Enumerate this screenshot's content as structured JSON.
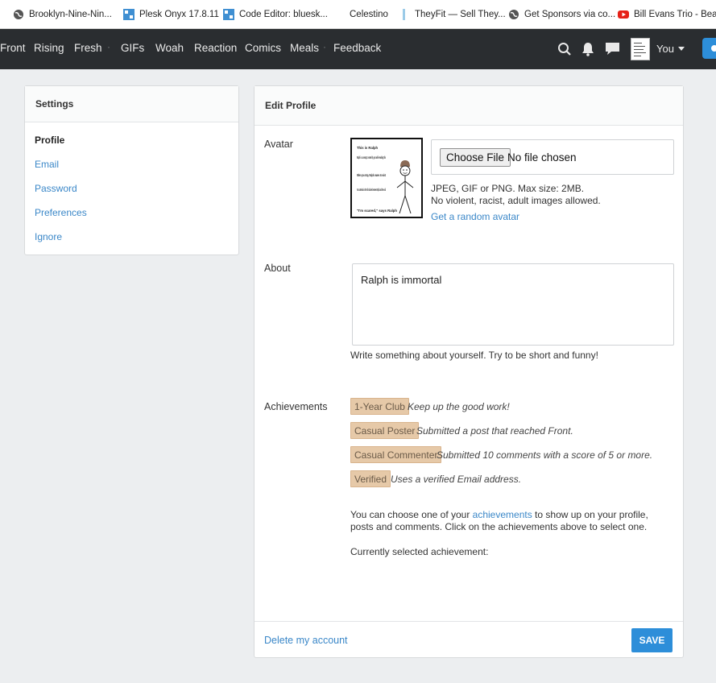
{
  "bookmarks": [
    {
      "label": "Brooklyn-Nine-Nin...",
      "icon": "globe-icon"
    },
    {
      "label": "Plesk Onyx 17.8.11",
      "icon": "plesk-icon"
    },
    {
      "label": "Code Editor: bluesk...",
      "icon": "plesk-icon"
    },
    {
      "label": "Celestino",
      "icon": "crescent-icon"
    },
    {
      "label": "TheyFit — Sell They...",
      "icon": "bar-icon"
    },
    {
      "label": "Get Sponsors via co...",
      "icon": "globe-icon"
    },
    {
      "label": "Bill Evans Trio - Bea...",
      "icon": "youtube-icon"
    }
  ],
  "nav": {
    "items": [
      "Front",
      "Rising",
      "Fresh",
      "GIFs",
      "Woah",
      "Reaction",
      "Comics",
      "Meals",
      "Feedback"
    ],
    "separator": "·",
    "user_label": "You"
  },
  "settings": {
    "title": "Settings",
    "links": [
      "Profile",
      "Email",
      "Password",
      "Preferences",
      "Ignore"
    ]
  },
  "edit_profile": {
    "title": "Edit Profile",
    "avatar": {
      "label": "Avatar",
      "choose_file": "Choose File",
      "file_status": "No file chosen",
      "hint_line1": "JPEG, GIF or PNG. Max size: 2MB.",
      "hint_line2": "No violent, racist, adult images allowed.",
      "random_link": "Get a random avatar",
      "image_text": {
        "t1": "This is Ralph",
        "t2": "Ralph is a concept, created by you while reading this",
        "t3": "When you stop, Ralph ceases to exist",
        "t4": "Your attention is the thin barrier between Ralph and the void",
        "t5": "\"I'm scared,\" says Ralph"
      }
    },
    "about": {
      "label": "About",
      "value": "Ralph is immortal",
      "hint": "Write something about yourself. Try to be short and funny!"
    },
    "achievements": {
      "label": "Achievements",
      "items": [
        {
          "name": "1-Year Club",
          "desc": "Keep up the good work!"
        },
        {
          "name": "Casual Poster",
          "desc": "Submitted a post that reached Front."
        },
        {
          "name": "Casual Commenter",
          "desc": "Submitted 10 comments with a score of 5 or more."
        },
        {
          "name": "Verified",
          "desc": "Uses a verified Email address."
        }
      ],
      "info_pre": "You can choose one of your ",
      "info_link": "achievements",
      "info_post": " to show up on your profile, posts and comments. Click on the achievements above to select one.",
      "selected_label": "Currently selected achievement:"
    },
    "delete_link": "Delete my account",
    "save_label": "SAVE"
  },
  "colors": {
    "nav_bg": "#2a2d30",
    "accent": "#2d8ed9",
    "link": "#3a87c8",
    "badge_bg": "#e6c9a8"
  }
}
